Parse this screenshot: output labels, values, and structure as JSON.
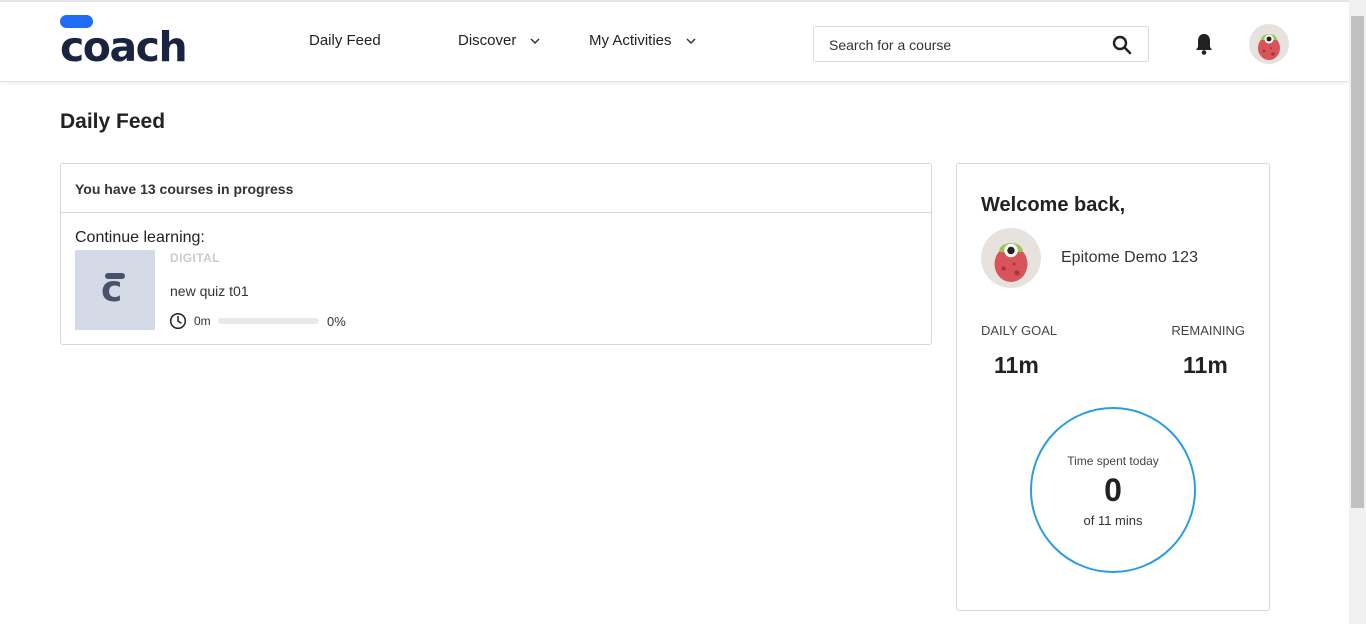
{
  "brand": {
    "name": "coach",
    "accent": "#1e6df6",
    "ring_color": "#2b9be4"
  },
  "nav": {
    "daily_feed": "Daily Feed",
    "discover": "Discover",
    "my_activities": "My Activities"
  },
  "search": {
    "placeholder": "Search for a course",
    "icon": "search-icon"
  },
  "header_icons": [
    "bell-icon",
    "user-avatar"
  ],
  "page": {
    "title": "Daily Feed"
  },
  "courses": {
    "summary": "You have 13 courses in progress",
    "continue_label": "Continue learning:",
    "items": [
      {
        "category": "DIGITAL",
        "name": "new quiz t01",
        "time_spent": "0m",
        "progress_percent": 0,
        "progress_label": "0%"
      }
    ]
  },
  "welcome": {
    "greeting": "Welcome back,",
    "user_name": "Epitome Demo 123",
    "daily_goal_label": "DAILY GOAL",
    "daily_goal_value": "11m",
    "remaining_label": "REMAINING",
    "remaining_value": "11m",
    "time_spent_label": "Time spent today",
    "time_spent_value": "0",
    "time_spent_of": "of 11 mins"
  }
}
